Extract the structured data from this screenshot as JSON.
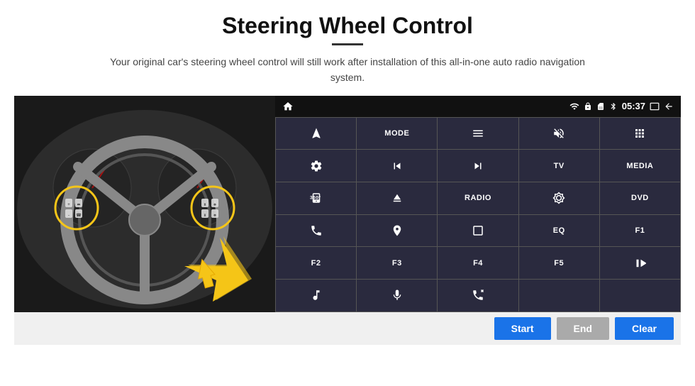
{
  "header": {
    "title": "Steering Wheel Control",
    "subtitle": "Your original car's steering wheel control will still work after installation of this all-in-one auto radio navigation system."
  },
  "status_bar": {
    "time": "05:37",
    "icons": [
      "wifi",
      "lock",
      "sim",
      "bluetooth",
      "battery",
      "screen-mirror",
      "back"
    ]
  },
  "grid_buttons": [
    {
      "id": "nav",
      "icon": "nav",
      "label": ""
    },
    {
      "id": "mode",
      "icon": "",
      "label": "MODE"
    },
    {
      "id": "menu",
      "icon": "menu",
      "label": ""
    },
    {
      "id": "mute",
      "icon": "mute",
      "label": ""
    },
    {
      "id": "apps",
      "icon": "apps",
      "label": ""
    },
    {
      "id": "settings",
      "icon": "settings",
      "label": ""
    },
    {
      "id": "rewind",
      "icon": "rewind",
      "label": ""
    },
    {
      "id": "forward",
      "icon": "forward",
      "label": ""
    },
    {
      "id": "tv",
      "icon": "",
      "label": "TV"
    },
    {
      "id": "media",
      "icon": "",
      "label": "MEDIA"
    },
    {
      "id": "cam360",
      "icon": "360cam",
      "label": ""
    },
    {
      "id": "eject",
      "icon": "eject",
      "label": ""
    },
    {
      "id": "radio",
      "icon": "",
      "label": "RADIO"
    },
    {
      "id": "brightness",
      "icon": "brightness",
      "label": ""
    },
    {
      "id": "dvd",
      "icon": "",
      "label": "DVD"
    },
    {
      "id": "phone",
      "icon": "phone",
      "label": ""
    },
    {
      "id": "nav2",
      "icon": "compass",
      "label": ""
    },
    {
      "id": "rectangle",
      "icon": "rect",
      "label": ""
    },
    {
      "id": "eq",
      "icon": "",
      "label": "EQ"
    },
    {
      "id": "f1",
      "icon": "",
      "label": "F1"
    },
    {
      "id": "f2",
      "icon": "",
      "label": "F2"
    },
    {
      "id": "f3",
      "icon": "",
      "label": "F3"
    },
    {
      "id": "f4",
      "icon": "",
      "label": "F4"
    },
    {
      "id": "f5",
      "icon": "",
      "label": "F5"
    },
    {
      "id": "playpause",
      "icon": "playpause",
      "label": ""
    },
    {
      "id": "music",
      "icon": "music",
      "label": ""
    },
    {
      "id": "mic",
      "icon": "mic",
      "label": ""
    },
    {
      "id": "call",
      "icon": "call",
      "label": ""
    },
    {
      "id": "empty1",
      "icon": "",
      "label": ""
    },
    {
      "id": "empty2",
      "icon": "",
      "label": ""
    }
  ],
  "bottom_buttons": {
    "start": "Start",
    "end": "End",
    "clear": "Clear"
  }
}
